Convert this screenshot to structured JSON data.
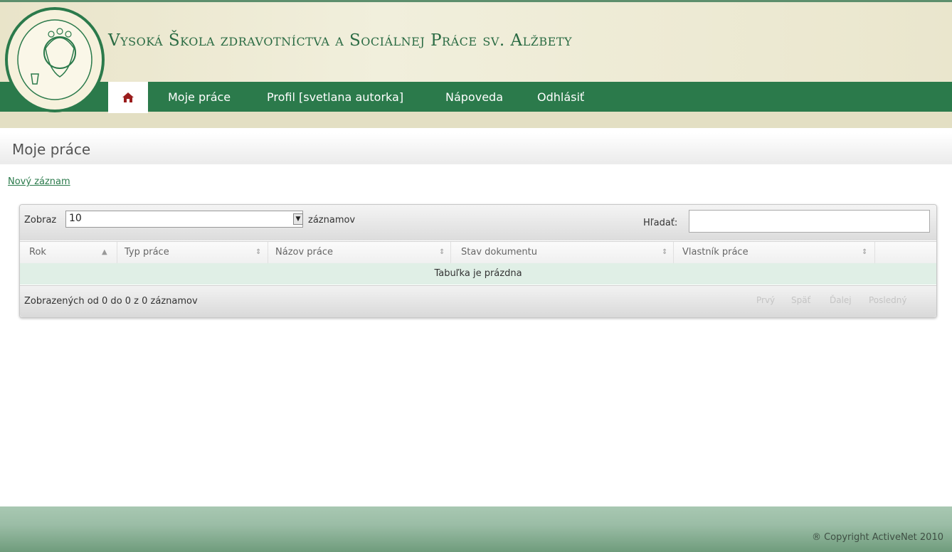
{
  "header": {
    "title": "Vysoká Škola zdravotníctva a Sociálnej  Práce sv. Alžbety",
    "logo_text": "VYSOKÁ ŠKOLA ZDRAVOTNÍCTVA A SOCIÁLNEJ PRÁCE SV. ALŽBETY",
    "nav": {
      "home_icon": "home-icon",
      "items": [
        {
          "label": "Moje práce"
        },
        {
          "label": "Profil [svetlana autorka]"
        },
        {
          "label": "Nápoveda"
        },
        {
          "label": "Odhlásiť"
        }
      ]
    }
  },
  "page": {
    "title": "Moje práce",
    "new_record_link": "Nový záznam"
  },
  "table": {
    "length_label_prefix": "Zobraz",
    "length_value": "10",
    "length_label_suffix": "záznamov",
    "search_label": "Hľadať:",
    "search_value": "",
    "columns": [
      {
        "label": "Rok",
        "sort": "▲"
      },
      {
        "label": "Typ práce",
        "sort": "⇕"
      },
      {
        "label": "Názov práce",
        "sort": "⇕"
      },
      {
        "label": "Stav dokumentu",
        "sort": "⇕"
      },
      {
        "label": "Vlastník práce",
        "sort": "⇕"
      }
    ],
    "empty_message": "Tabuľka je prázdna",
    "info": "Zobrazených od 0 do 0 z 0 záznamov",
    "pager": {
      "first": "Prvý",
      "prev": "Späť",
      "next": "Ďalej",
      "last": "Posledný"
    }
  },
  "footer": {
    "copyright": "® Copyright ActiveNet 2010"
  },
  "colors": {
    "brand_green": "#2b7a4b",
    "header_beige": "#ece8d0",
    "empty_row": "#e0efe6"
  }
}
